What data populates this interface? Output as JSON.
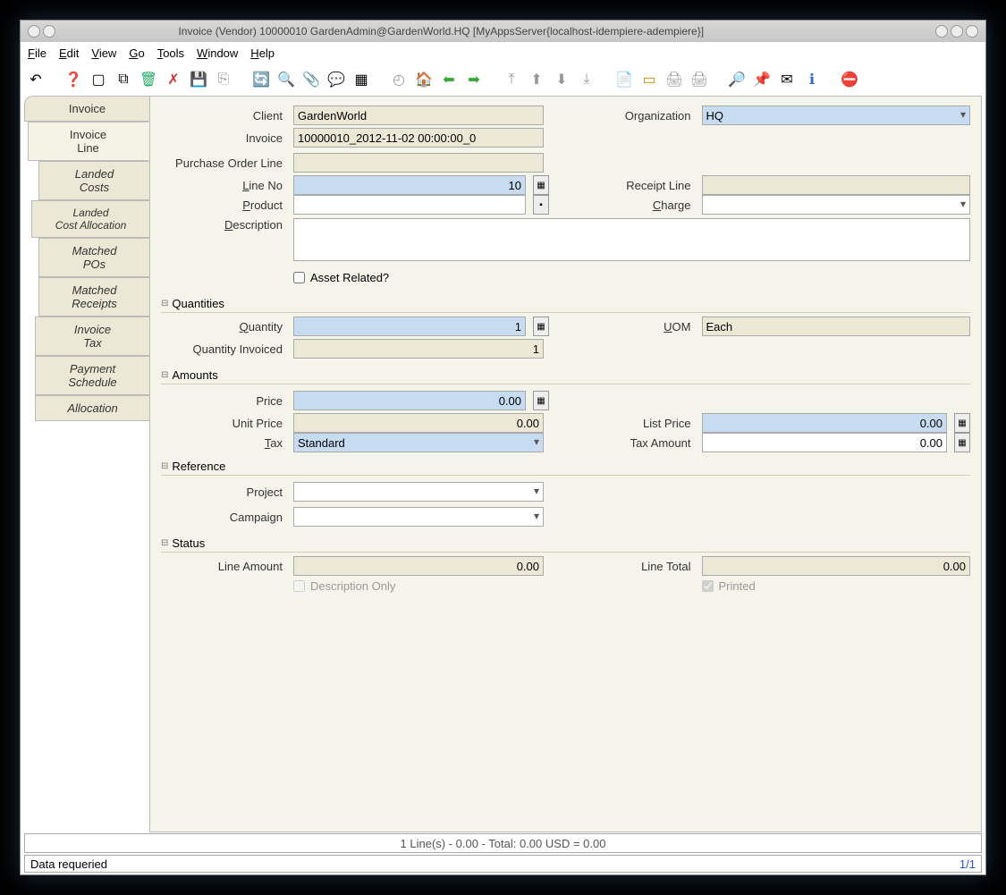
{
  "window": {
    "title": "Invoice (Vendor)  10000010  GardenAdmin@GardenWorld.HQ [MyAppsServer{localhost-idempiere-adempiere}]"
  },
  "menu": {
    "file": "File",
    "edit": "Edit",
    "view": "View",
    "go": "Go",
    "tools": "Tools",
    "window": "Window",
    "help": "Help"
  },
  "tabs": {
    "invoice": "Invoice",
    "invoice_line": "Invoice\nLine",
    "landed_costs": "Landed\nCosts",
    "landed_alloc": "Landed\nCost Allocation",
    "matched_pos": "Matched\nPOs",
    "matched_rcpt": "Matched\nReceipts",
    "invoice_tax": "Invoice\nTax",
    "pay_sched": "Payment\nSchedule",
    "allocation": "Allocation"
  },
  "labels": {
    "client": "Client",
    "organization": "Organization",
    "invoice": "Invoice",
    "pol": "Purchase Order Line",
    "lineno": "Line No",
    "receipt": "Receipt Line",
    "product": "Product",
    "charge": "Charge",
    "description": "Description",
    "asset": "Asset Related?",
    "quantities": "Quantities",
    "quantity": "Quantity",
    "uom": "UOM",
    "qty_inv": "Quantity Invoiced",
    "amounts": "Amounts",
    "price": "Price",
    "unit_price": "Unit Price",
    "list_price": "List Price",
    "tax": "Tax",
    "tax_amount": "Tax Amount",
    "reference": "Reference",
    "project": "Project",
    "campaign": "Campaign",
    "status": "Status",
    "line_amount": "Line Amount",
    "line_total": "Line Total",
    "desc_only": "Description Only",
    "printed": "Printed"
  },
  "values": {
    "client": "GardenWorld",
    "organization": "HQ",
    "invoice": "10000010_2012-11-02 00:00:00_0",
    "lineno": "10",
    "quantity": "1",
    "uom": "Each",
    "qty_inv": "1",
    "price": "0.00",
    "unit_price": "0.00",
    "list_price": "0.00",
    "tax": "Standard",
    "tax_amount": "0.00",
    "line_amount": "0.00",
    "line_total": "0.00"
  },
  "status": {
    "summary": "1 Line(s) - 0.00 -  Total: 0.00  USD  =  0.00",
    "message": "Data requeried",
    "page": "1/1"
  }
}
